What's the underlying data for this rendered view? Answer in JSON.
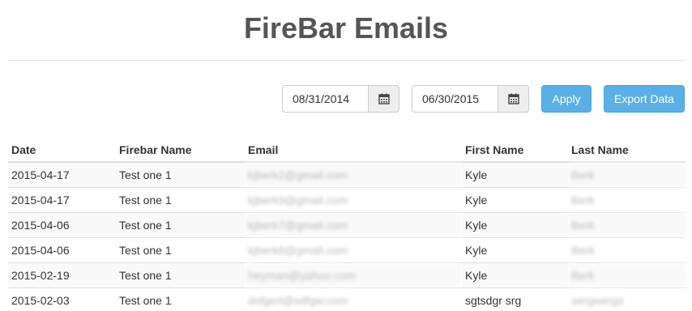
{
  "page": {
    "title": "FireBar Emails"
  },
  "filters": {
    "start_date": "08/31/2014",
    "end_date": "06/30/2015",
    "apply_label": "Apply",
    "export_label": "Export Data"
  },
  "table": {
    "headers": [
      "Date",
      "Firebar Name",
      "Email",
      "First Name",
      "Last Name"
    ],
    "rows": [
      [
        "2015-04-17",
        "Test one 1",
        "kjberk2@gmail.com",
        "Kyle",
        "Berk"
      ],
      [
        "2015-04-17",
        "Test one 1",
        "kjberk9@gmail.com",
        "Kyle",
        "Berk"
      ],
      [
        "2015-04-06",
        "Test one 1",
        "kjberk7@gmail.com",
        "Kyle",
        "Berk"
      ],
      [
        "2015-04-06",
        "Test one 1",
        "kjberk6@gmail.com",
        "Kyle",
        "Berk"
      ],
      [
        "2015-02-19",
        "Test one 1",
        "heyman@yahoo.com",
        "Kyle",
        "Berk"
      ],
      [
        "2015-02-03",
        "Test one 1",
        "dsfgert@sdfgw.com",
        "sgtsdgr srg",
        "sergwergs"
      ]
    ]
  },
  "icons": {
    "calendar": "calendar-icon"
  },
  "colors": {
    "accent": "#5aafe6",
    "header_rule": "#dddddd",
    "stripe": "#f9f9f9"
  }
}
